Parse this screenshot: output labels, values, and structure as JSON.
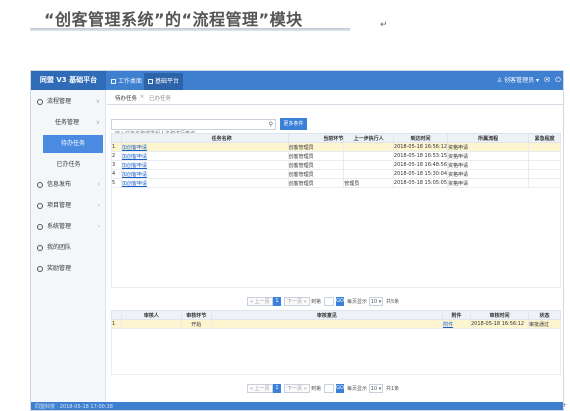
{
  "doc": {
    "heading": "“创客管理系统”的“流程管理”模块",
    "return_mark": "↵"
  },
  "app": {
    "brand": "同盟 V3 基础平台",
    "top_tabs": [
      {
        "label": "工作桌面",
        "active": false
      },
      {
        "label": "基础平台",
        "active": true
      }
    ],
    "user_menu": "创客管理员 ▾",
    "icons": {
      "mail": "✉",
      "power": "⏻"
    },
    "sidebar": {
      "items": [
        {
          "label": "流程管理",
          "chevron": "∨"
        },
        {
          "label": "信息发布",
          "chevron": "›"
        },
        {
          "label": "项目管理",
          "chevron": "›"
        },
        {
          "label": "系统管理",
          "chevron": "›"
        },
        {
          "label": "我的团队",
          "chevron": ""
        },
        {
          "label": "奖励管理",
          "chevron": ""
        }
      ],
      "group": {
        "label": "任务管理",
        "chevron": "∨"
      },
      "subitems": [
        {
          "label": "待办任务",
          "active": true
        },
        {
          "label": "已办任务",
          "active": false
        }
      ]
    },
    "subtabs": {
      "pending": "待办任务",
      "close": "×",
      "done": "已办任务"
    },
    "search": {
      "placeholder": "输入任务名称或发起人名称进行查询",
      "more_button": "更多条件",
      "icon": "🔍"
    },
    "tasks": {
      "headers": [
        "",
        "任务名称",
        "当前环节",
        "上一步执行人",
        "到达时间",
        "所属流程",
        "紧急程度"
      ],
      "rows": [
        {
          "no": "1",
          "name": "加创客申请",
          "step": "创客管理员",
          "prev": "",
          "time": "2018-05-18 16:56:12",
          "process": "资格申请",
          "urgency": ""
        },
        {
          "no": "2",
          "name": "加创客申请",
          "step": "创客管理员",
          "prev": "",
          "time": "2018-05-18 16:53:15",
          "process": "资格申请",
          "urgency": ""
        },
        {
          "no": "3",
          "name": "加创客申请",
          "step": "创客管理员",
          "prev": "",
          "time": "2018-05-18 16:48:56",
          "process": "资格申请",
          "urgency": ""
        },
        {
          "no": "4",
          "name": "加创客申请",
          "step": "创客管理员",
          "prev": "",
          "time": "2018-05-18 15:30:04",
          "process": "资格申请",
          "urgency": ""
        },
        {
          "no": "5",
          "name": "加创客申请",
          "step": "创客管理员",
          "prev": "管理员",
          "time": "2018-05-18 15:05:05",
          "process": "资格申请",
          "urgency": ""
        }
      ]
    },
    "pager": {
      "prev": "« 上一页",
      "page": "1",
      "next": "下一页 »",
      "goto": "到第",
      "confirm": "确定",
      "per_page_label": "每页显示",
      "per_page": "10 ▾",
      "total": "共5条",
      "go": "GO"
    },
    "audit": {
      "headers": [
        "",
        "审核人",
        "审核环节",
        "审核意见",
        "附件",
        "审核时间",
        "状态"
      ],
      "rows": [
        {
          "no": "1",
          "reviewer": "",
          "step": "开始",
          "opinion": "",
          "attachment": "附件",
          "time": "2018-05-18 16:56:12",
          "status": "审批通过"
        }
      ]
    },
    "pager2": {
      "prev": "« 上一页",
      "page": "1",
      "next": "下一页 »",
      "goto": "到第",
      "confirm": "确定",
      "per_page_label": "每页显示",
      "per_page": "10 ▾",
      "total": "共1条",
      "go": "GO"
    },
    "footer": "同盟科技 · 2018-05-18 17:00:38"
  },
  "corner_mark": "+"
}
